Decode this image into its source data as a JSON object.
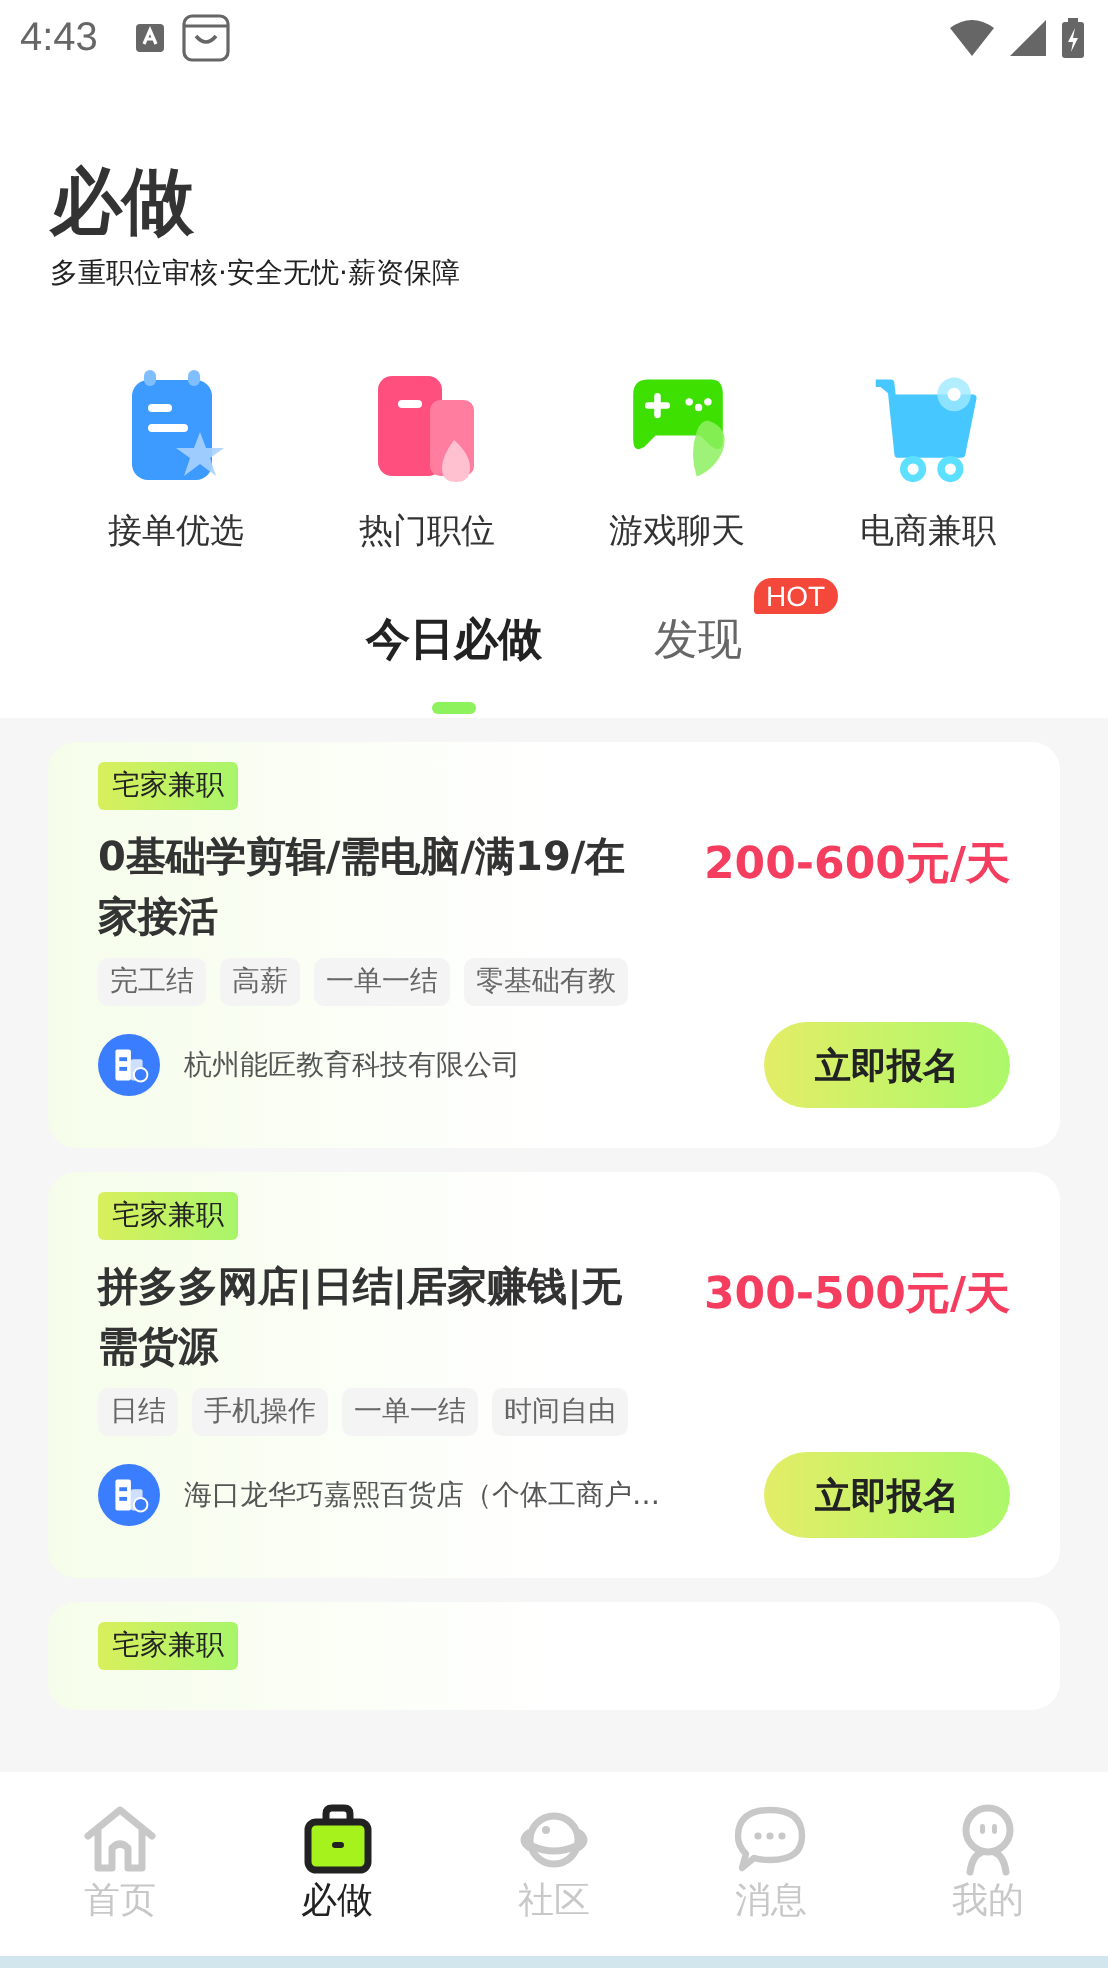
{
  "status_bar": {
    "time": "4:43"
  },
  "header": {
    "title": "必做",
    "subtitle": "多重职位审核·安全无忧·薪资保障"
  },
  "categories": [
    {
      "label": "接单优选",
      "kind": "notepad"
    },
    {
      "label": "热门职位",
      "kind": "flame"
    },
    {
      "label": "游戏聊天",
      "kind": "gamepad"
    },
    {
      "label": "电商兼职",
      "kind": "cart"
    }
  ],
  "tabs": [
    {
      "label": "今日必做",
      "selected": true
    },
    {
      "label": "发现",
      "selected": false,
      "badge": "HOT"
    }
  ],
  "jobs": [
    {
      "tag": "宅家兼职",
      "title": "0基础学剪辑/需电脑/满19/在家接活",
      "salary": "200-600元/天",
      "tags": [
        "完工结",
        "高薪",
        "一单一结",
        "零基础有教"
      ],
      "company": "杭州能匠教育科技有限公司",
      "button": "立即报名"
    },
    {
      "tag": "宅家兼职",
      "title": "拼多多网店|日结|居家赚钱|无需货源",
      "salary": "300-500元/天",
      "tags": [
        "日结",
        "手机操作",
        "一单一结",
        "时间自由"
      ],
      "company": "海口龙华巧嘉熙百货店（个体工商户…",
      "button": "立即报名"
    },
    {
      "tag": "宅家兼职"
    }
  ],
  "bottom_nav": [
    {
      "label": "首页",
      "kind": "home",
      "selected": false
    },
    {
      "label": "必做",
      "kind": "bag",
      "selected": true
    },
    {
      "label": "社区",
      "kind": "planet",
      "selected": false
    },
    {
      "label": "消息",
      "kind": "chat",
      "selected": false
    },
    {
      "label": "我的",
      "kind": "person",
      "selected": false
    }
  ]
}
